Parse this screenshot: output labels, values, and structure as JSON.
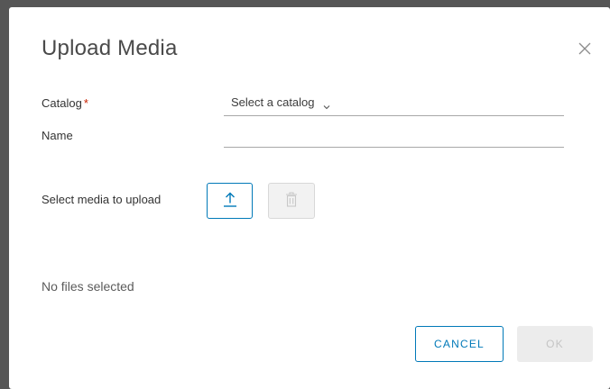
{
  "dialog": {
    "title": "Upload Media",
    "close_icon": "close-icon"
  },
  "form": {
    "catalog": {
      "label": "Catalog",
      "required_marker": "*",
      "selected_value": "Select a catalog",
      "icon": "chevron-down-icon"
    },
    "name": {
      "label": "Name",
      "value": ""
    },
    "media": {
      "label": "Select media to upload",
      "upload_icon": "upload-arrow-icon",
      "delete_icon": "trash-icon"
    }
  },
  "status": {
    "text": "No files selected"
  },
  "footer": {
    "cancel_label": "CANCEL",
    "ok_label": "OK"
  },
  "colors": {
    "accent": "#0079b8",
    "required": "#c92100",
    "disabled_bg": "#ececec",
    "disabled_text": "#c4c4c4"
  }
}
